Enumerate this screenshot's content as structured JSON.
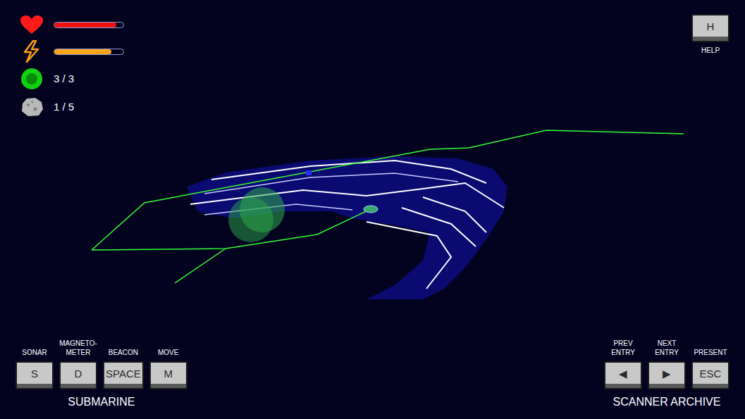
{
  "hud": {
    "health": {
      "level": 0.9
    },
    "energy": {
      "level": 0.83
    },
    "beacons": "3 / 3",
    "samples": "1 / 5"
  },
  "help": {
    "key": "H",
    "label": "HELP"
  },
  "control_groups": [
    {
      "title": "SUBMARINE",
      "keys": [
        {
          "key": "S",
          "label_lines": [
            "SONAR"
          ]
        },
        {
          "key": "D",
          "label_lines": [
            "MAGNETO-",
            "METER"
          ]
        },
        {
          "key": "SPACE",
          "label_lines": [
            "BEACON"
          ]
        },
        {
          "key": "M",
          "label_lines": [
            "MOVE"
          ]
        }
      ]
    },
    {
      "title": "SCANNER ARCHIVE",
      "keys": [
        {
          "key": "◀",
          "label_lines": [
            "PREV",
            "ENTRY"
          ]
        },
        {
          "key": "▶",
          "label_lines": [
            "NEXT",
            "ENTRY"
          ]
        },
        {
          "key": "ESC",
          "label_lines": [
            "PRESENT"
          ]
        }
      ]
    }
  ]
}
